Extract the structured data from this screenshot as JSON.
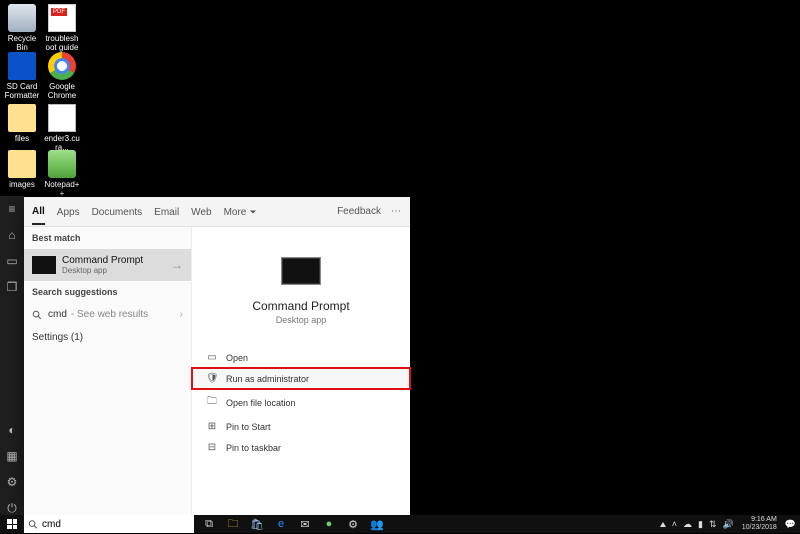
{
  "desktop": {
    "icons": [
      {
        "label": "Recycle Bin"
      },
      {
        "label": "troubleshoot guide"
      },
      {
        "label": "SD Card Formatter"
      },
      {
        "label": "Google Chrome"
      },
      {
        "label": "files"
      },
      {
        "label": "ender3.cura..."
      },
      {
        "label": "images"
      },
      {
        "label": "Notepad++"
      }
    ]
  },
  "search": {
    "tabs": [
      "All",
      "Apps",
      "Documents",
      "Email",
      "Web",
      "More"
    ],
    "feedback": "Feedback",
    "best_match_header": "Best match",
    "best_match": {
      "title": "Command Prompt",
      "subtitle": "Desktop app"
    },
    "suggestions_header": "Search suggestions",
    "suggestion": {
      "term": "cmd",
      "hint": "- See web results"
    },
    "settings_header": "Settings (1)",
    "preview": {
      "title": "Command Prompt",
      "subtitle": "Desktop app"
    },
    "actions": [
      {
        "label": "Open"
      },
      {
        "label": "Run as administrator"
      },
      {
        "label": "Open file location"
      },
      {
        "label": "Pin to Start"
      },
      {
        "label": "Pin to taskbar"
      }
    ],
    "input_value": "cmd"
  },
  "taskbar": {
    "time": "9:16 AM",
    "date": "10/23/2018"
  }
}
